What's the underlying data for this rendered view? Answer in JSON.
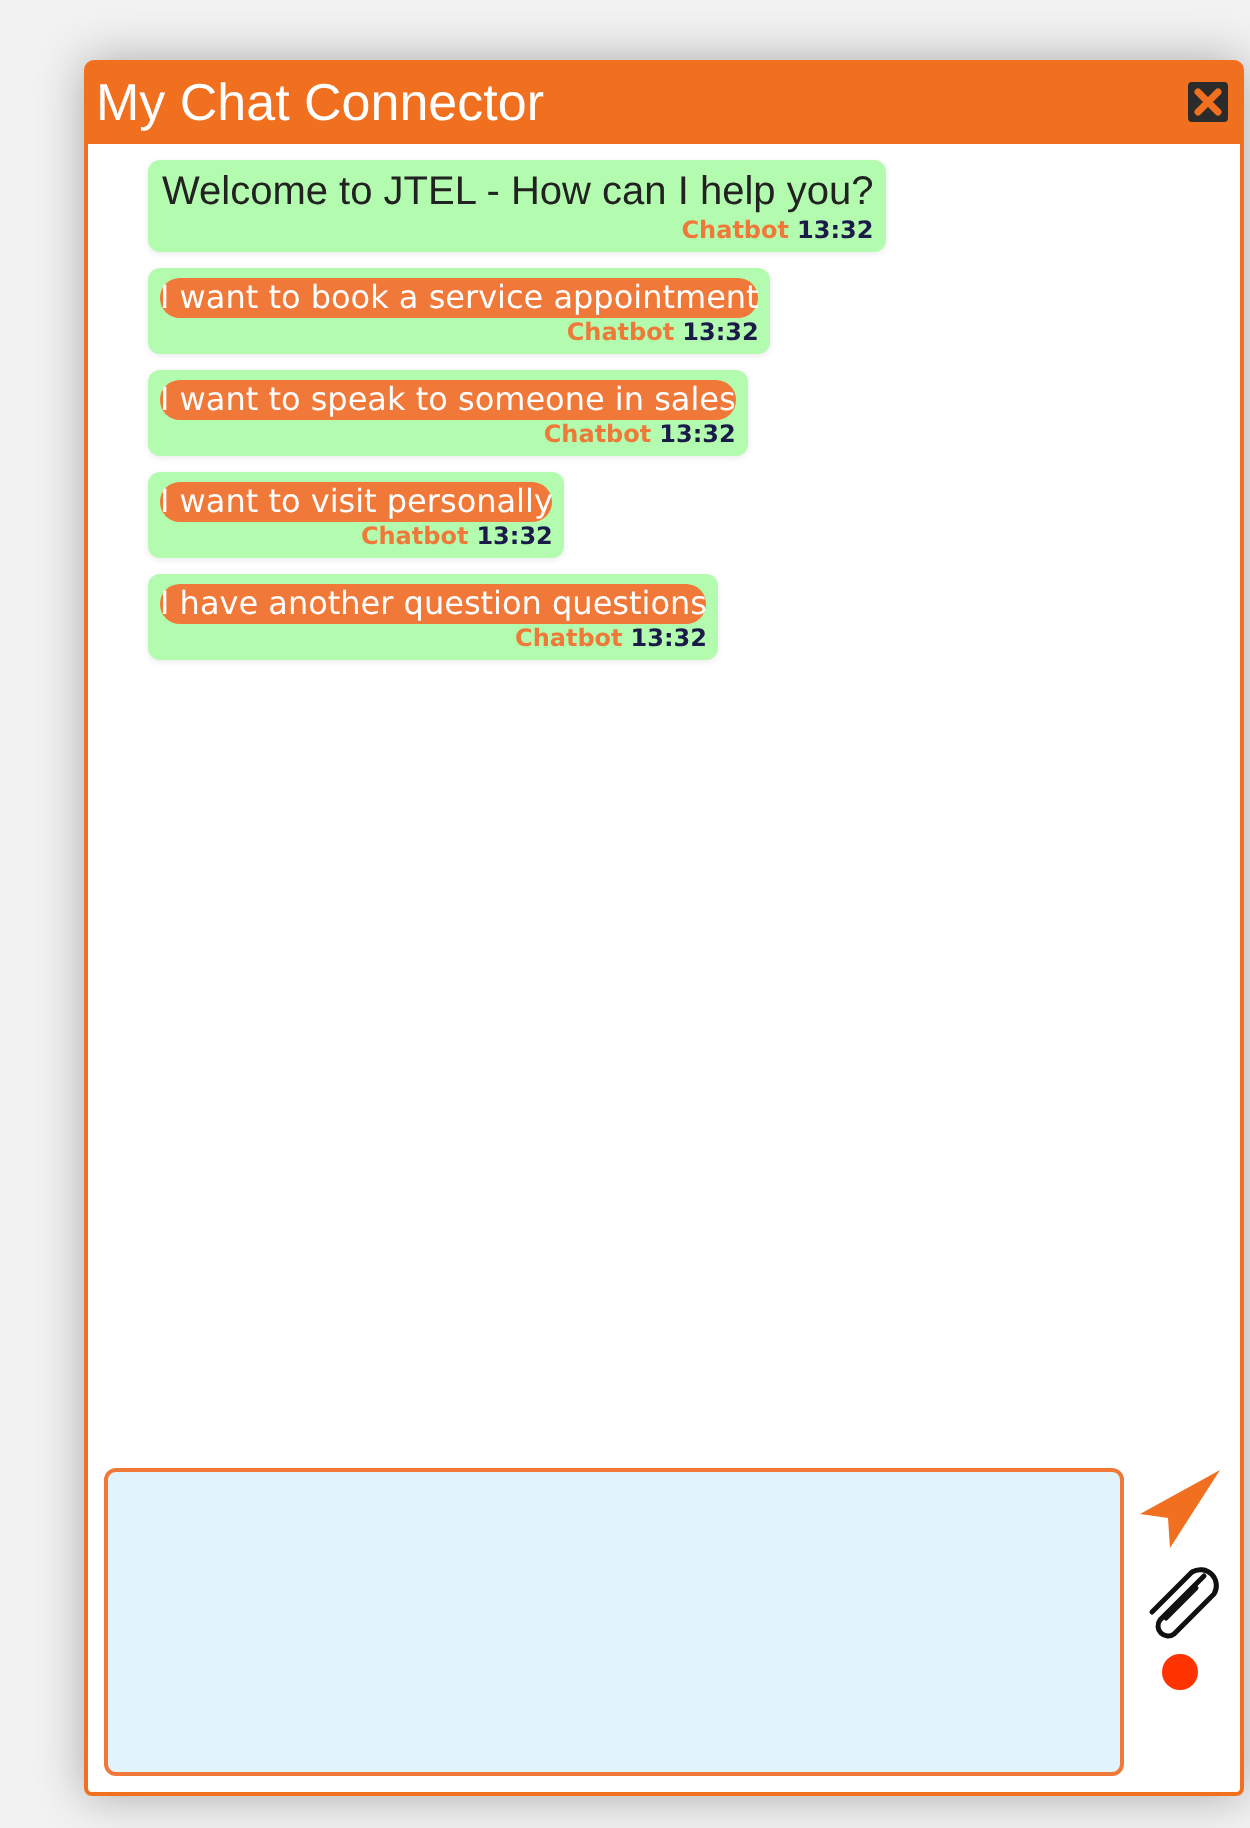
{
  "window": {
    "title": "My Chat Connector"
  },
  "messages": [
    {
      "kind": "text",
      "text": "Welcome to JTEL - How can I help you?",
      "sender": "Chatbot",
      "time": "13:32"
    },
    {
      "kind": "option",
      "text": "I want to book a service appointment",
      "sender": "Chatbot",
      "time": "13:32"
    },
    {
      "kind": "option",
      "text": "I want to speak to someone in sales",
      "sender": "Chatbot",
      "time": "13:32"
    },
    {
      "kind": "option",
      "text": "I want to visit personally",
      "sender": "Chatbot",
      "time": "13:32"
    },
    {
      "kind": "option",
      "text": "I have another question questions",
      "sender": "Chatbot",
      "time": "13:32"
    }
  ],
  "recording": true
}
